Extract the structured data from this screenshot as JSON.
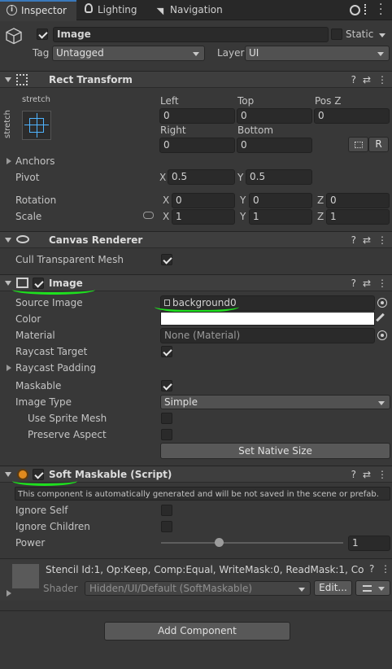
{
  "tabs": [
    {
      "label": "Inspector",
      "icon": "info-icon"
    },
    {
      "label": "Lighting",
      "icon": "lightbulb-icon"
    },
    {
      "label": "Navigation",
      "icon": "navigation-icon"
    }
  ],
  "gameobject": {
    "name": "Image",
    "static_label": "Static",
    "tag_label": "Tag",
    "tag_value": "Untagged",
    "layer_label": "Layer",
    "layer_value": "UI"
  },
  "rect_transform": {
    "title": "Rect Transform",
    "anchor_preset_top": "stretch",
    "anchor_preset_side": "stretch",
    "left_label": "Left",
    "left": "0",
    "top_label": "Top",
    "top": "0",
    "posz_label": "Pos Z",
    "posz": "0",
    "right_label": "Right",
    "right": "0",
    "bottom_label": "Bottom",
    "bottom": "0",
    "r_button": "R",
    "anchors_label": "Anchors",
    "pivot_label": "Pivot",
    "pivot_x": "0.5",
    "pivot_y": "0.5",
    "rotation_label": "Rotation",
    "rot_x": "0",
    "rot_y": "0",
    "rot_z": "0",
    "scale_label": "Scale",
    "scale_x": "1",
    "scale_y": "1",
    "scale_z": "1",
    "x": "X",
    "y": "Y",
    "z": "Z"
  },
  "canvas_renderer": {
    "title": "Canvas Renderer",
    "cull_label": "Cull Transparent Mesh"
  },
  "image": {
    "title": "Image",
    "source_label": "Source Image",
    "source_value": "background0",
    "color_label": "Color",
    "color_value": "#ffffff",
    "material_label": "Material",
    "material_value": "None (Material)",
    "raycast_label": "Raycast Target",
    "padding_label": "Raycast Padding",
    "maskable_label": "Maskable",
    "type_label": "Image Type",
    "type_value": "Simple",
    "sprite_mesh_label": "Use Sprite Mesh",
    "preserve_label": "Preserve Aspect",
    "native_button": "Set Native Size"
  },
  "soft_maskable": {
    "title": "Soft Maskable (Script)",
    "notice": "This component is automatically generated and will be not saved in the scene or prefab.",
    "ignore_self_label": "Ignore Self",
    "ignore_children_label": "Ignore Children",
    "power_label": "Power",
    "power_value": "1",
    "power_slider": 0.31
  },
  "material_preview": {
    "stencil": "Stencil Id:1, Op:Keep, Comp:Equal, WriteMask:0, ReadMask:1, Co",
    "shader_label": "Shader",
    "shader_value": "Hidden/UI/Default (SoftMaskable)",
    "edit_button": "Edit..."
  },
  "add_component": "Add Component",
  "colors": {
    "annotation": "#1ee01e",
    "panel": "#383838",
    "header": "#3e3e3e"
  }
}
